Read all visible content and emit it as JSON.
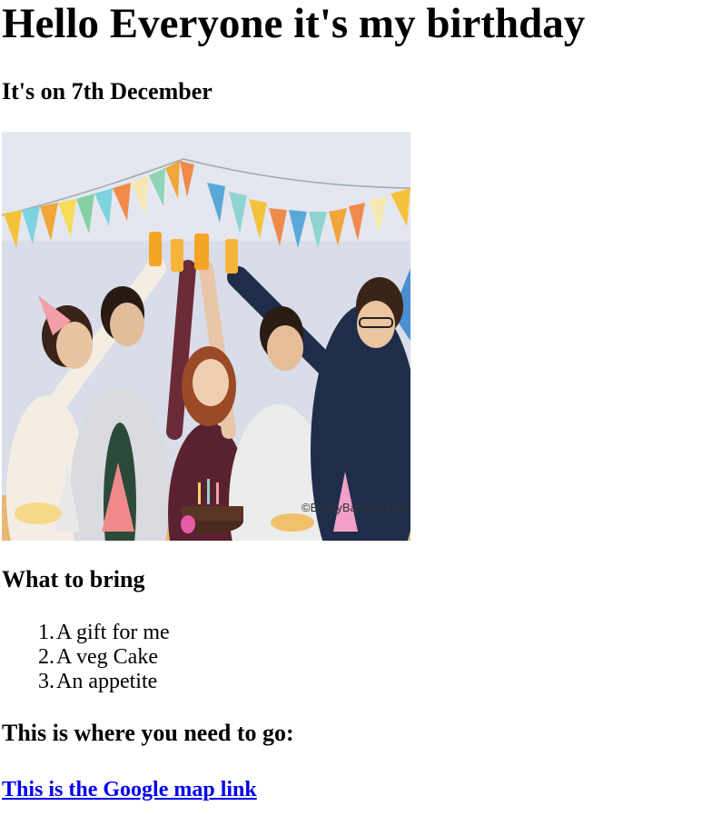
{
  "heading": "Hello Everyone it's my birthday",
  "date_line": "It's on 7th December",
  "image": {
    "alt": "birthday party photo",
    "watermark": "©EssayBanyan.com"
  },
  "bring_section": {
    "heading": "What to bring",
    "items": [
      {
        "number": "1.",
        "text": "A gift for me"
      },
      {
        "number": "2.",
        "text": "A veg Cake"
      },
      {
        "number": "3.",
        "text": "An appetite"
      }
    ]
  },
  "location_section": {
    "heading": "This is where you need to go:",
    "link_text": "This is the Google map link"
  },
  "colors": {
    "link": "#0000ee",
    "text": "#000000",
    "background": "#ffffff"
  }
}
